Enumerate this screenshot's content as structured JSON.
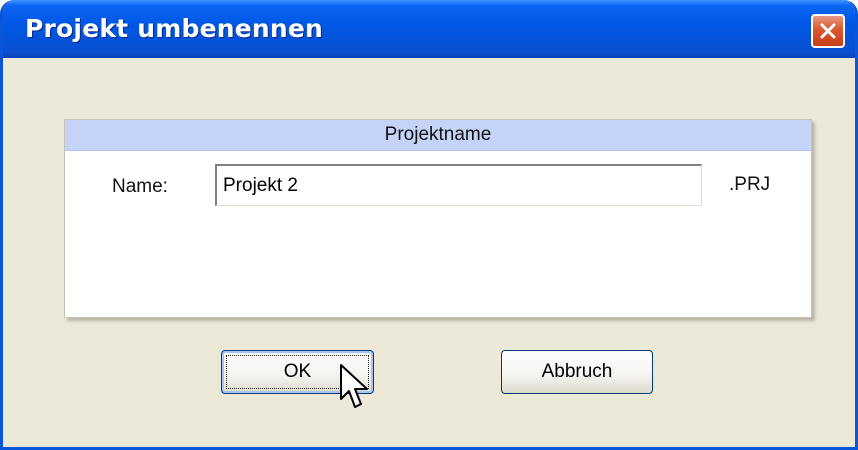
{
  "window": {
    "title": "Projekt umbenennen"
  },
  "group": {
    "header": "Projektname",
    "name_label": "Name:",
    "name_value": "Projekt 2",
    "extension": ".PRJ"
  },
  "buttons": {
    "ok_label": "OK",
    "cancel_label": "Abbruch"
  },
  "icons": {
    "close": "close-icon",
    "cursor": "mouse-cursor"
  },
  "colors": {
    "titlebar": "#0058e6",
    "dialog_bg": "#ece9d8",
    "group_header": "#c4d3f7",
    "close_button": "#d9572e"
  }
}
